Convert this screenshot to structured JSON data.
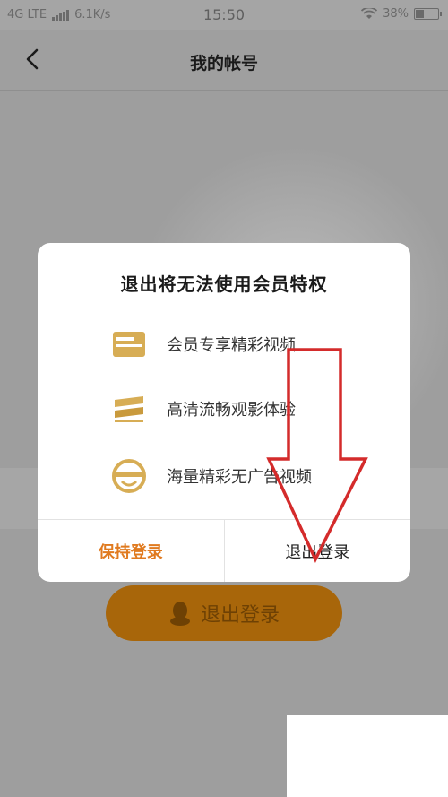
{
  "status_bar": {
    "network": "4G LTE",
    "speed": "6.1K/s",
    "time": "15:50",
    "battery": "38%"
  },
  "header": {
    "title": "我的帐号"
  },
  "background": {
    "logout_button_label": "退出登录"
  },
  "dialog": {
    "title": "退出将无法使用会员特权",
    "features": [
      {
        "icon": "vip-card-icon",
        "label": "会员专享精彩视频"
      },
      {
        "icon": "hd-icon",
        "label": "高清流畅观影体验"
      },
      {
        "icon": "no-ads-icon",
        "label": "海量精彩无广告视频"
      }
    ],
    "keep_button": "保持登录",
    "logout_button": "退出登录",
    "accent_color": "#e07a1f"
  }
}
